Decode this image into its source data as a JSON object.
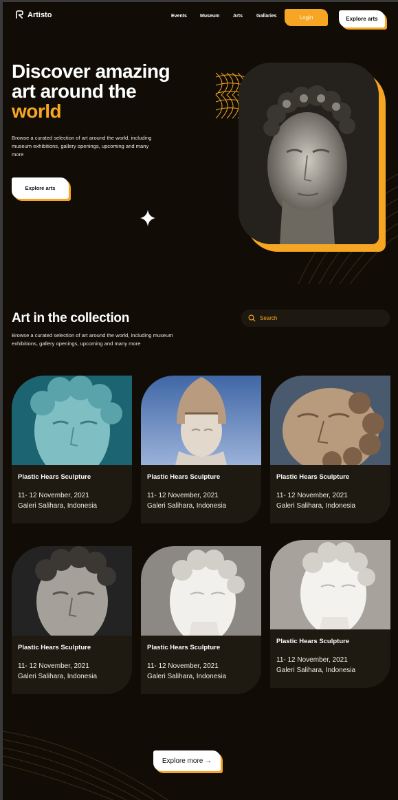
{
  "nav": {
    "brand": "Artisto",
    "links": [
      "Events",
      "Museum",
      "Arts",
      "Gallaries"
    ],
    "login_label": "Login",
    "explore_label": "Explore arts"
  },
  "hero": {
    "title_line1": "Discover amazing",
    "title_line2": "art around the",
    "title_highlight": "world",
    "description": "Browse a curated selection of art around the world, including museum exhibitions, gallery openings, upcoming and many more",
    "button_label": "Explore arts"
  },
  "collection": {
    "title": "Art in the collection",
    "description": "Browse a curated selection of art around the world, including museum exhibitions, gallery openings, upcoming and many more",
    "search_placeholder": "Search",
    "cards": [
      {
        "title": "Plastic Hears Sculpture",
        "date": "11- 12 November, 2021",
        "place": "Galeri Salihara, Indonesia"
      },
      {
        "title": "Plastic Hears Sculpture",
        "date": "11- 12 November, 2021",
        "place": "Galeri Salihara, Indonesia"
      },
      {
        "title": "Plastic Hears Sculpture",
        "date": "11- 12 November, 2021",
        "place": "Galeri Salihara, Indonesia"
      },
      {
        "title": "Plastic Hears Sculpture",
        "date": "11- 12 November, 2021",
        "place": "Galeri Salihara, Indonesia"
      },
      {
        "title": "Plastic Hears Sculpture",
        "date": "11- 12 November, 2021",
        "place": "Galeri Salihara, Indonesia"
      },
      {
        "title": "Plastic Hears Sculpture",
        "date": "11- 12 November, 2021",
        "place": "Galeri Salihara, Indonesia"
      }
    ],
    "more_label": "Explore more →"
  },
  "colors": {
    "accent": "#f6a623",
    "background": "#110d06",
    "card": "#1e1a11"
  }
}
